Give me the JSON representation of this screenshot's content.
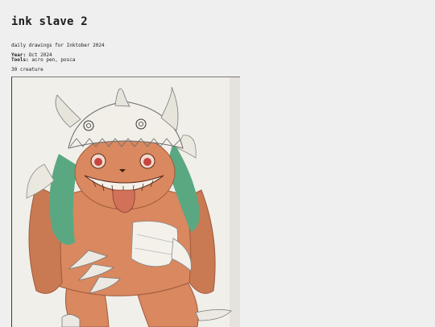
{
  "page": {
    "title": "ink slave 2",
    "description": "daily drawings for Inktober 2024",
    "year_label": "Year:",
    "year_value": "Oct 2024",
    "tools_label": "Tools:",
    "tools_value": "acro pen, posca",
    "caption": "30 creature"
  },
  "artwork": {
    "subject": "creature-drawing",
    "colors": {
      "paper": "#f1efea",
      "body": "#d9885f",
      "body_shade": "#b96a49",
      "hair": "#5aa882",
      "helmet": "#f2efe8",
      "horn": "#e7e4dc",
      "eye": "#c5463f"
    }
  }
}
